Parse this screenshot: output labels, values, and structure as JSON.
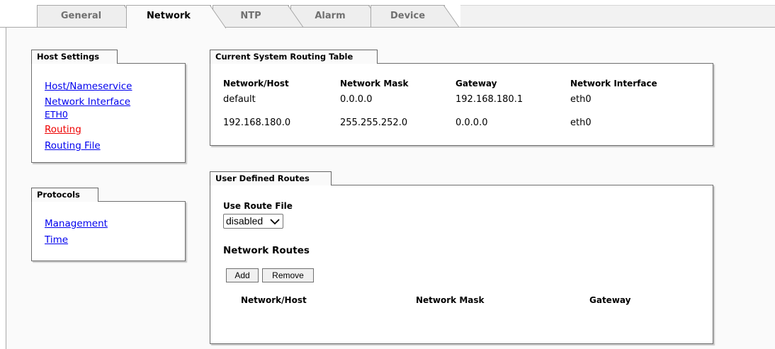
{
  "tabs": [
    {
      "label": "General",
      "active": false
    },
    {
      "label": "Network",
      "active": true
    },
    {
      "label": "NTP",
      "active": false
    },
    {
      "label": "Alarm",
      "active": false
    },
    {
      "label": "Device",
      "active": false
    }
  ],
  "host_settings": {
    "title": "Host Settings",
    "links": [
      {
        "label": "Host/Nameservice",
        "current": false
      },
      {
        "label": "Network Interface",
        "current": false
      },
      {
        "label": "ETH0",
        "current": false
      },
      {
        "label": "Routing",
        "current": true
      },
      {
        "label": "Routing File",
        "current": false
      }
    ]
  },
  "protocols": {
    "title": "Protocols",
    "links": [
      {
        "label": "Management"
      },
      {
        "label": "Time"
      }
    ]
  },
  "routing_table": {
    "title": "Current System Routing Table",
    "columns": [
      "Network/Host",
      "Network Mask",
      "Gateway",
      "Network Interface"
    ],
    "rows": [
      [
        "default",
        "0.0.0.0",
        "192.168.180.1",
        "eth0"
      ],
      [
        "192.168.180.0",
        "255.255.252.0",
        "0.0.0.0",
        "eth0"
      ]
    ]
  },
  "user_routes": {
    "title": "User Defined Routes",
    "use_route_file_label": "Use Route File",
    "use_route_file_value": "disabled",
    "network_routes_heading": "Network Routes",
    "add_label": "Add",
    "remove_label": "Remove",
    "columns": [
      "Network/Host",
      "Network Mask",
      "Gateway"
    ]
  },
  "colors": {
    "link": "#0000ee",
    "current_link": "#ee0000",
    "panel_background": "#fafafa"
  }
}
